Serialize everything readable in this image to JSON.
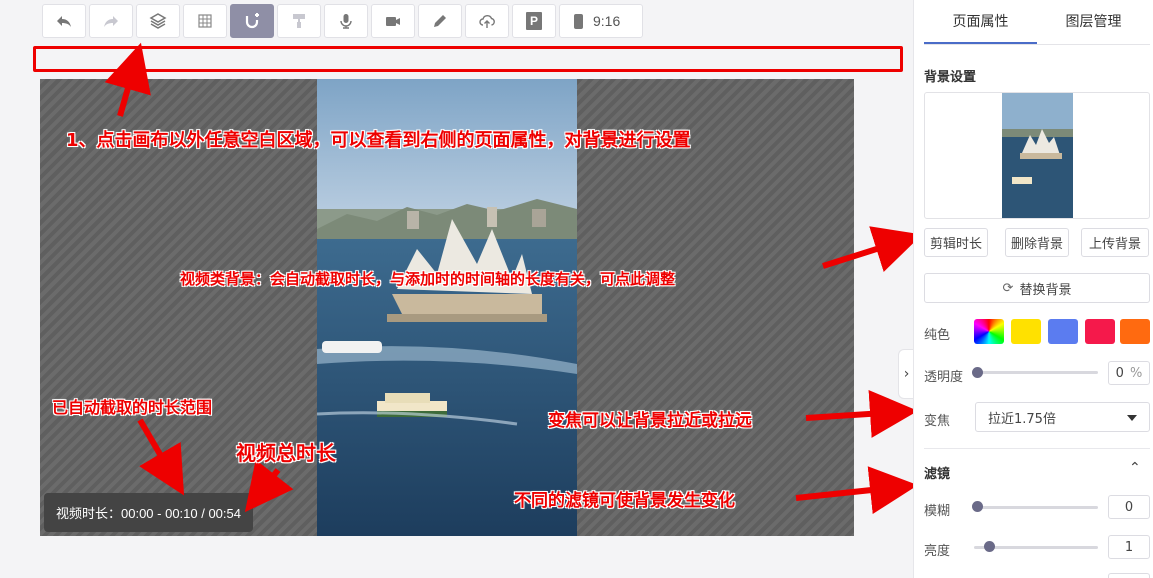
{
  "toolbar": {
    "buttons": [
      {
        "icon": "undo-icon"
      },
      {
        "icon": "redo-icon"
      },
      {
        "icon": "layers-icon"
      },
      {
        "icon": "grid-icon"
      },
      {
        "icon": "magnet-icon"
      },
      {
        "icon": "format-painter-icon"
      },
      {
        "icon": "microphone-icon"
      },
      {
        "icon": "video-camera-icon"
      },
      {
        "icon": "pen-icon"
      },
      {
        "icon": "cloud-upload-icon"
      },
      {
        "icon": "parking-p-icon"
      }
    ],
    "p_letter": "P",
    "aspect_ratio": "9:16"
  },
  "canvas": {
    "duration_label": "视频时长：00:00 - 00:10 / 00:54"
  },
  "annotations": {
    "step1": "1、点击画布以外任意空白区域，可以查看到右侧的页面属性，对背景进行设置",
    "video_bg": "视频类背景：会自动截取时长，与添加时的时间轴的长度有关，可点此调整",
    "clipped_range": "已自动截取的时长范围",
    "total_duration": "视频总时长",
    "zoom": "变焦可以让背景拉近或拉远",
    "filters": "不同的滤镜可使背景发生变化"
  },
  "panel": {
    "tabs": [
      "页面属性",
      "图层管理"
    ],
    "bg_settings_title": "背景设置",
    "buttons": {
      "clip_duration": "剪辑时长",
      "delete_bg": "删除背景",
      "upload_bg": "上传背景",
      "replace_bg": "替换背景"
    },
    "solid_color_label": "纯色",
    "swatch_colors": [
      "#ffe100",
      "#5b7cf0",
      "#f5194b",
      "#ff6a10"
    ],
    "opacity_label": "透明度",
    "opacity_value": "0",
    "opacity_unit": "%",
    "zoom_label": "变焦",
    "zoom_value": "拉近1.75倍",
    "filters_title": "滤镜",
    "blur_label": "模糊",
    "blur_value": "0",
    "brightness_label": "亮度",
    "brightness_value": "1"
  },
  "colors": {
    "accent": "#4a6cc8",
    "annotation": "#ee0000"
  }
}
